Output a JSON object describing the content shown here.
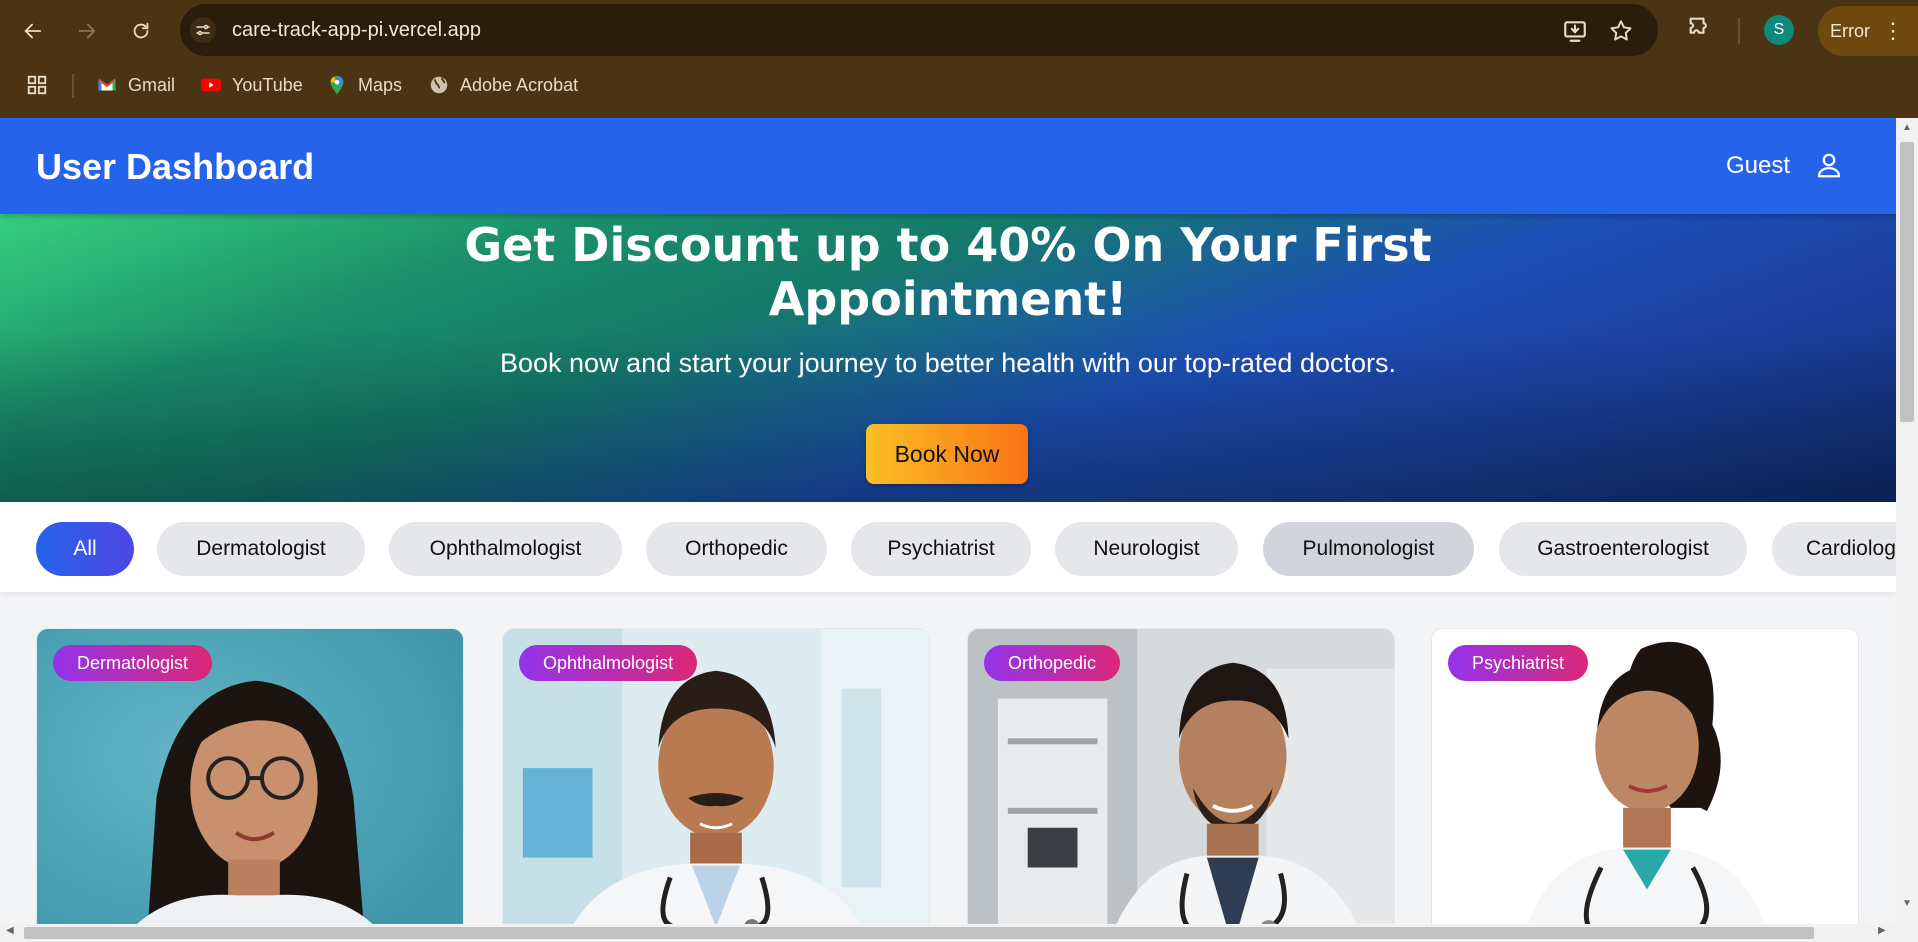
{
  "browser": {
    "url": "care-track-app-pi.vercel.app",
    "profile_initial": "S",
    "error_label": "Error",
    "bookmarks": [
      {
        "label": "Gmail",
        "icon": "gmail-icon"
      },
      {
        "label": "YouTube",
        "icon": "youtube-icon"
      },
      {
        "label": "Maps",
        "icon": "maps-icon"
      },
      {
        "label": "Adobe Acrobat",
        "icon": "globe-icon"
      }
    ]
  },
  "header": {
    "title": "User Dashboard",
    "user_label": "Guest"
  },
  "hero": {
    "title": "Get Discount up to 40% On Your First Appointment!",
    "subtitle": "Book now and start your journey to better health with our top-rated doctors.",
    "cta_label": "Book Now"
  },
  "filters": [
    {
      "label": "All",
      "active": true
    },
    {
      "label": "Dermatologist"
    },
    {
      "label": "Ophthalmologist"
    },
    {
      "label": "Orthopedic"
    },
    {
      "label": "Psychiatrist"
    },
    {
      "label": "Neurologist"
    },
    {
      "label": "Pulmonologist"
    },
    {
      "label": "Gastroenterologist"
    },
    {
      "label": "Cardiologist"
    }
  ],
  "doctors": [
    {
      "specialty": "Dermatologist"
    },
    {
      "specialty": "Ophthalmologist"
    },
    {
      "specialty": "Orthopedic"
    },
    {
      "specialty": "Psychiatrist"
    }
  ],
  "colors": {
    "header": "#2563eb",
    "chrome": "#4a3413",
    "badge_start": "#9333ea",
    "badge_end": "#db2777",
    "cta_start": "#fbbf24",
    "cta_end": "#f97316"
  }
}
